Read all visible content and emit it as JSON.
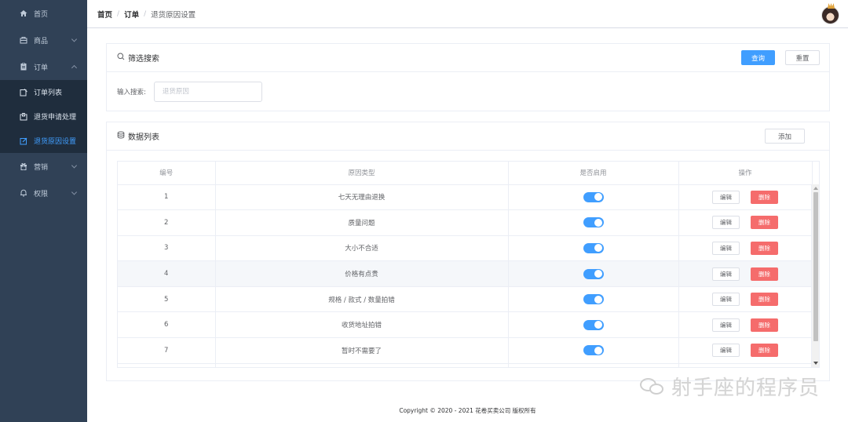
{
  "sidebar": {
    "items": [
      {
        "label": "首页",
        "icon": "home-icon"
      },
      {
        "label": "商品",
        "icon": "goods-icon"
      },
      {
        "label": "订单",
        "icon": "order-icon"
      },
      {
        "label": "营销",
        "icon": "marketing-icon"
      },
      {
        "label": "权限",
        "icon": "permission-icon"
      }
    ],
    "order_submenu": [
      {
        "label": "订单列表",
        "icon": "order-list-icon"
      },
      {
        "label": "退货申请处理",
        "icon": "return-apply-icon"
      },
      {
        "label": "退货原因设置",
        "icon": "return-reason-icon",
        "active": true
      }
    ],
    "active_color": "#409eff",
    "bg_color": "#304156"
  },
  "header": {
    "breadcrumb": [
      "首页",
      "订单",
      "退货原因设置"
    ],
    "breadcrumb_separator": "/"
  },
  "filter": {
    "title": "筛选搜索",
    "search_button": "查询",
    "reset_button": "重置",
    "input_label": "输入搜索:",
    "input_placeholder": "退货原因",
    "input_value": ""
  },
  "list": {
    "title": "数据列表",
    "add_button": "添加",
    "columns": [
      "编号",
      "原因类型",
      "是否启用",
      "操作"
    ],
    "rows": [
      {
        "id": "1",
        "reason": "七天无理由退换",
        "enabled": true
      },
      {
        "id": "2",
        "reason": "质量问题",
        "enabled": true
      },
      {
        "id": "3",
        "reason": "大小不合适",
        "enabled": true
      },
      {
        "id": "4",
        "reason": "价格有点贵",
        "enabled": true
      },
      {
        "id": "5",
        "reason": "规格 / 款式 / 数量拍错",
        "enabled": true
      },
      {
        "id": "6",
        "reason": "收货地址拍错",
        "enabled": true
      },
      {
        "id": "7",
        "reason": "暂时不需要了",
        "enabled": true
      }
    ],
    "edit_label": "编辑",
    "delete_label": "删除"
  },
  "footer": {
    "copyright": "Copyright © 2020 - 2021 花卷买卖公司 版权所有"
  },
  "watermark": {
    "text": "射手座的程序员"
  },
  "colors": {
    "primary": "#409eff",
    "danger": "#f56c6c"
  }
}
